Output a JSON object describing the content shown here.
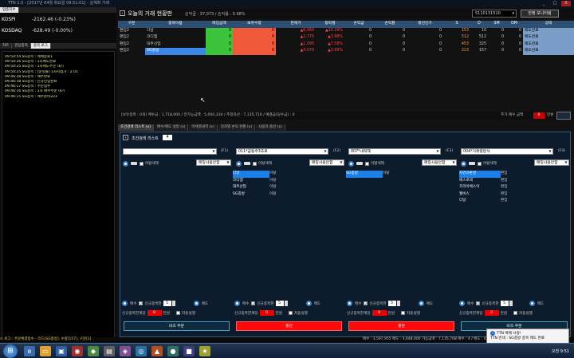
{
  "window": {
    "title": "TTN 1.0 - [2017년 04월 화요일 09:51:01] - 실계좌 거래",
    "controls": [
      "_",
      "□",
      "X"
    ]
  },
  "left": {
    "tab_index": "업종지수",
    "indices": [
      {
        "name": "KOSPI",
        "value": "-2162.46 (-0.23%)"
      },
      {
        "name": "KOSDAQ",
        "value": "-628.49 (-0.00%)"
      }
    ],
    "tabs": [
      "차트",
      "관심종목",
      "종목 로그"
    ],
    "logs": [
      "09:50:54 SG종목 : 매매종료1",
      "09:50:26 SG종목 : 1차매도완료",
      "09:50:25 SG종목 : 1차매도주문 대기",
      "09:50:25 SG종목 : (순익률) 1차지점가 : 2.01",
      "09:46:38 SG종목 : 매수완료",
      "09:46:38 SG종목 : 신규진입완료",
      "09:46:17 SG종목 : 주문접수",
      "09:46:16 SG종목 : 1차 매수주문 대기",
      "09:46:15 SG종목 : 매수준비223"
    ]
  },
  "header": {
    "panel_name": "오늘의 거래 현황판",
    "stats": "손익금 : 37,073  /  손익률 : 0.98%",
    "account": "5110131510",
    "display_button": "안정 모니터링"
  },
  "table": {
    "columns": [
      "구분",
      "종목이름",
      "매입금액",
      "보유수량",
      "현재가",
      "등락률",
      "손익금",
      "손익률",
      "평단단가",
      "S",
      "D",
      "SM",
      "DM",
      "상태"
    ],
    "rows": [
      {
        "cat": "편입2",
        "name": "다날",
        "buy": "0",
        "qty": "0",
        "price": "▲6,160",
        "rate": "▲10.29%",
        "pnl": "0",
        "prate": "0",
        "avg": "0",
        "s": "153",
        "d": "10",
        "sm": "0",
        "dm": "0",
        "status": "매도완료"
      },
      {
        "cat": "편입2",
        "name": "코디엠",
        "buy": "0",
        "qty": "0",
        "price": "▲1,775",
        "rate": "▲3.98%",
        "pnl": "0",
        "prate": "0",
        "avg": "0",
        "s": "512",
        "d": "512",
        "sm": "0",
        "dm": "0",
        "status": "매도완료"
      },
      {
        "cat": "편입2",
        "name": "대주산업",
        "buy": "0",
        "qty": "0",
        "price": "▲1,095",
        "rate": "▲7.58%",
        "pnl": "0",
        "prate": "0",
        "avg": "0",
        "s": "453",
        "d": "325",
        "sm": "0",
        "dm": "0",
        "status": "매도완료"
      },
      {
        "cat": "편입2",
        "name": "SG충방",
        "buy": "0",
        "qty": "0",
        "price": "▲4,070",
        "rate": "▲3.99%",
        "pnl": "0",
        "prate": "0",
        "avg": "0",
        "s": "223",
        "d": "157",
        "sm": "0",
        "dm": "0",
        "status": "매도완료"
      }
    ]
  },
  "summary": {
    "text": "[보유종목 : 0개]        매수금 : 1,718,000  /  만가능금액 : 5,000,334  /  추정자산 : 7,135,716  /  예결금(당수금) : 0",
    "add_buy_label": "추가 매수 금액",
    "add_buy_value": "0",
    "add_buy_unit": "만원"
  },
  "subtabs": [
    "조건검색 리스트 (x)",
    "매수/매도 설정 (x)",
    "미체결내역 (x)",
    "일자별 손익 현황 (x)",
    "사용자 옵션 (x)"
  ],
  "cond": {
    "title": "조건검색 리스트",
    "count": "4",
    "cols": [
      {
        "select": "",
        "fkey": "(F1)",
        "check": "매칭사용안함",
        "option": "이탈색제",
        "items": [
          {
            "name": "다날",
            "state": "이탈"
          },
          {
            "name": "코디엠",
            "state": "이탈"
          },
          {
            "name": "대주산업",
            "state": "이탈"
          },
          {
            "name": "SG충방",
            "state": "이탈"
          }
        ]
      },
      {
        "select": "011*급등주3조로",
        "fkey": "(F2)",
        "check": "매칭사용안함",
        "option": "이탈색제",
        "items": []
      },
      {
        "select": "007*내떡해",
        "fkey": "(F3)",
        "check": "매칭사용안함",
        "option": "이탈색제",
        "items": [
          {
            "name": "SG충방",
            "state": "이탈"
          }
        ]
      },
      {
        "select": "004*거래량분석",
        "fkey": "(F4)",
        "check": "매칭사용안함",
        "option": "이탈색제",
        "items": [
          {
            "name": "자연과환경",
            "state": "편입"
          },
          {
            "name": "에스로넥",
            "state": "편입"
          },
          {
            "name": "코리아에스이",
            "state": "편입"
          },
          {
            "name": "월비스",
            "state": "편입"
          },
          {
            "name": "다날",
            "state": "편입"
          }
        ]
      }
    ],
    "bottom": [
      {
        "left1": "매수",
        "left2": "신규종목한",
        "num": "5",
        "right": "매도",
        "amount_label": "신규종목한계당",
        "amount": "0",
        "unit": "만원",
        "auto": "자동실행",
        "button": "비즈 주문"
      },
      {
        "left1": "매수",
        "left2": "신규종목한",
        "num": "5",
        "right": "매도",
        "amount_label": "신규종목한계당",
        "amount": "0",
        "unit": "만원",
        "auto": "자동실행",
        "button": "중단"
      },
      {
        "left1": "매수",
        "left2": "신규종목한",
        "num": "5",
        "right": "매도",
        "amount_label": "신규종목한계당",
        "amount": "0",
        "unit": "만원",
        "auto": "자동실행",
        "button": "중단"
      },
      {
        "left1": "매수",
        "left2": "신규종목한",
        "num": "5",
        "right": "매도",
        "amount_label": "신규종목한계당",
        "amount": "0",
        "unit": "만원",
        "auto": "자동실행",
        "button": "비즈 주문"
      }
    ]
  },
  "status": {
    "left": "  ⊙ 로그 : 주문체결접수  -  코드[SG충방], 수량[157], 구분[1]",
    "right": "매수 : 3,597,955  매도 : 3,648,000  가능금액 : 7,135,708     매수 : 4 / 매도 : 4"
  },
  "notification": {
    "title": "TTN 매매 사랑!",
    "text": "TTN 빈네 : SG충방 종목 매도 완료"
  },
  "taskbar": {
    "time": "오전 9:51"
  }
}
